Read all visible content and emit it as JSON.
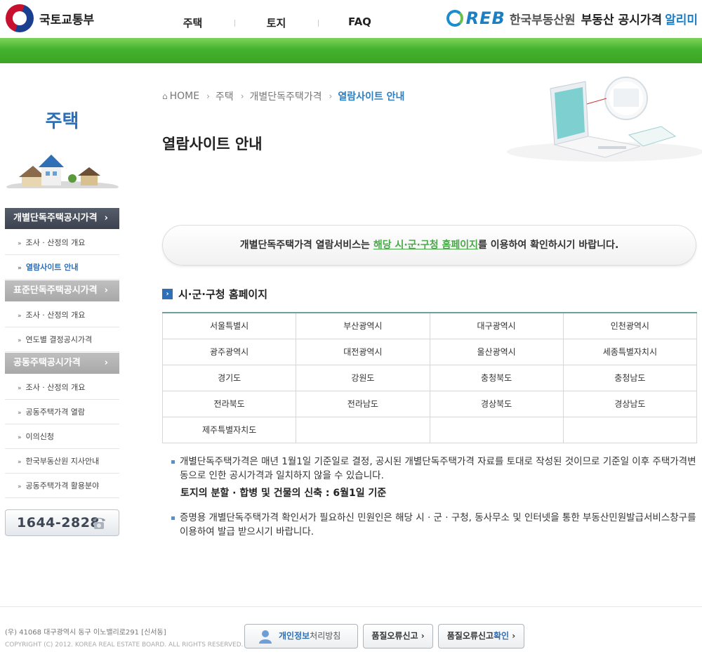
{
  "header": {
    "ministry": "국토교통부",
    "menu": [
      "주택",
      "토지",
      "FAQ"
    ],
    "brand": {
      "reb": "REB",
      "corp": "한국부동산원",
      "service": "부동산 공시가격",
      "service_accent": "알리미"
    }
  },
  "sidebar": {
    "title": "주택",
    "groups": [
      {
        "label": "개별단독주택공시가격",
        "arrow": "›",
        "items": [
          "조사 · 산정의 개요",
          "열람사이트 안내"
        ]
      },
      {
        "label": "표준단독주택공시가격",
        "arrow": "›",
        "items": [
          "조사 · 산정의 개요",
          "연도별 결정공시가격"
        ]
      },
      {
        "label": "공동주택공시가격",
        "arrow": "›",
        "items": [
          "조사 · 산정의 개요",
          "공동주택가격 열람",
          "이의신청",
          "한국부동산원 지사안내",
          "공동주택가격 활용분야"
        ]
      }
    ],
    "phone": "1644-2828"
  },
  "breadcrumb": {
    "home": "HOME",
    "level1": "주택",
    "level2": "개별단독주택가격",
    "current": "열람사이트 안내"
  },
  "page_title": "열람사이트 안내",
  "notice": {
    "before": "개별단독주택가격 열람서비스는 ",
    "highlight": "해당 시·군·구청 홈페이지",
    "after": "를 이용하여 확인하시기 바랍니다."
  },
  "section_title": "시·군·구청 홈페이지",
  "regions": [
    [
      "서울특별시",
      "부산광역시",
      "대구광역시",
      "인천광역시"
    ],
    [
      "광주광역시",
      "대전광역시",
      "울산광역시",
      "세종특별자치시"
    ],
    [
      "경기도",
      "강원도",
      "충청북도",
      "충청남도"
    ],
    [
      "전라북도",
      "전라남도",
      "경상북도",
      "경상남도"
    ],
    [
      "제주특별자치도",
      "",
      "",
      ""
    ]
  ],
  "notes": {
    "note1": "개별단독주택가격은 매년 1월1일 기준일로 결정, 공시된 개별단독주택가격 자료를 토대로 작성된 것이므로 기준일 이후 주택가격변동으로 인한 공시가격과 일치하지 않을 수 있습니다.",
    "note1_strong": "토지의 분할 · 합병 및 건물의 신축 : 6월1일 기준",
    "note2": "증명용 개별단독주택가격 확인서가 필요하신 민원인은 해당 시 · 군 · 구청, 동사무소 및 인터넷을 통한 부동산민원발급서비스창구를 이용하여 발급 받으시기 바랍니다."
  },
  "footer": {
    "address": "(우) 41068   대구광역시 동구 이노밸리로291 [신서동]",
    "copyright": "COPYRIGHT (C) 2012. KOREA REAL ESTATE BOARD. ALL RIGHTS RESERVED.",
    "privacy_blue": "개인정보",
    "privacy_rest": "처리방침",
    "error_report": "품질오류신고 ›",
    "error_check_a": "품질오류신고",
    "error_check_b": "확인",
    "error_check_arrow": " ›"
  },
  "colors": {
    "green_bar": "#44b22e",
    "brand_blue": "#1b7fc4",
    "accent_green": "#4aa84a",
    "nav_active": "#3c4250"
  }
}
